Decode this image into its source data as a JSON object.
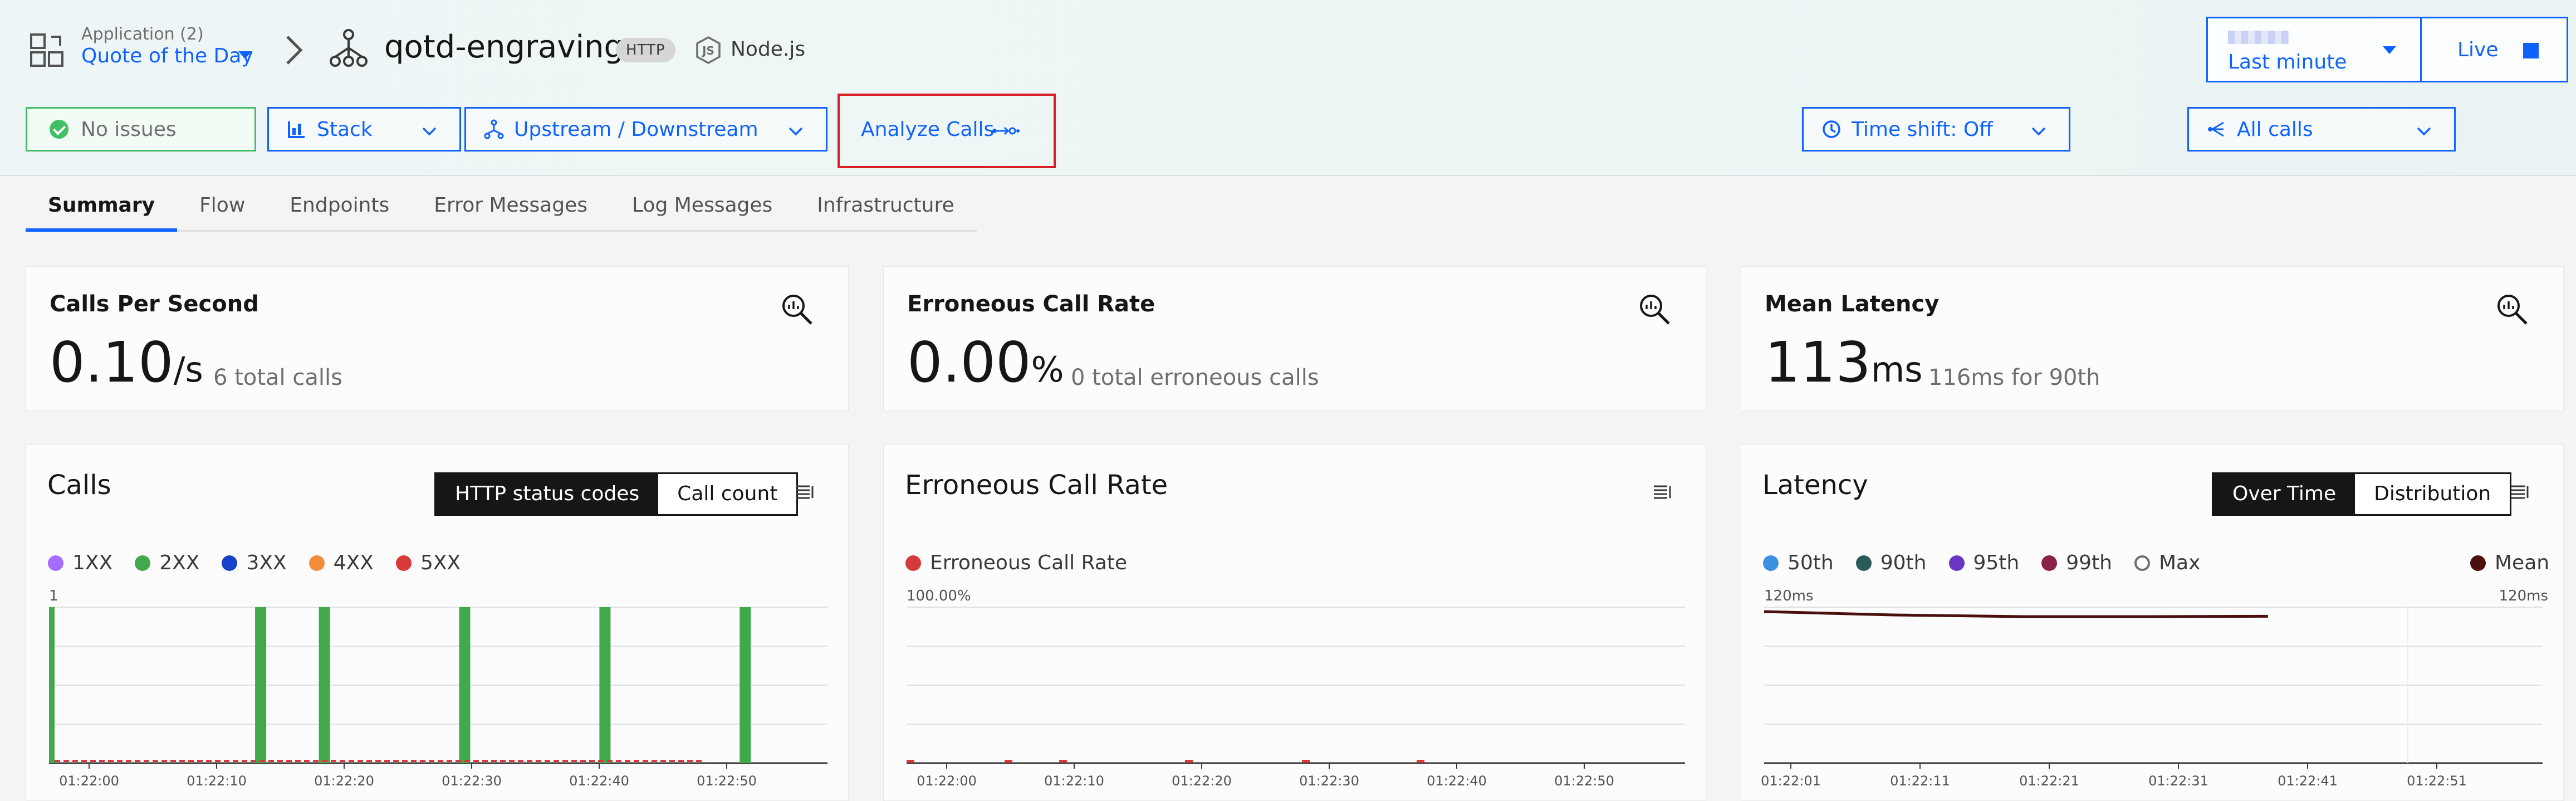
{
  "header": {
    "app_label": "Application (2)",
    "app_name": "Quote of the Day",
    "service_name": "qotd-engraving",
    "protocol_tag": "HTTP",
    "runtime_label": "Node.js",
    "status_label": "No issues",
    "stack_label": "Stack",
    "upstream_label": "Upstream / Downstream",
    "analyze_label": "Analyze Calls",
    "time_shift_label": "Time shift: Off",
    "all_calls_label": "All calls",
    "time_range_label": "Last minute",
    "live_label": "Live"
  },
  "tabs": [
    {
      "label": "Summary",
      "active": true
    },
    {
      "label": "Flow",
      "active": false
    },
    {
      "label": "Endpoints",
      "active": false
    },
    {
      "label": "Error Messages",
      "active": false
    },
    {
      "label": "Log Messages",
      "active": false
    },
    {
      "label": "Infrastructure",
      "active": false
    }
  ],
  "kpis": [
    {
      "title": "Calls Per Second",
      "value": "0.10",
      "unit": "/s",
      "sub": "6 total calls"
    },
    {
      "title": "Erroneous Call Rate",
      "value": "0.00",
      "unit": "%",
      "sub": "0 total erroneous calls"
    },
    {
      "title": "Mean Latency",
      "value": "113",
      "unit": "ms",
      "sub": "116ms for 90th"
    }
  ],
  "calls_panel": {
    "title": "Calls",
    "toggle": [
      "HTTP status codes",
      "Call count"
    ],
    "legend": [
      {
        "label": "1XX",
        "color": "#a56eff"
      },
      {
        "label": "2XX",
        "color": "#42a84c"
      },
      {
        "label": "3XX",
        "color": "#1741c9"
      },
      {
        "label": "4XX",
        "color": "#f08c3c"
      },
      {
        "label": "5XX",
        "color": "#d63a3a"
      }
    ]
  },
  "error_panel": {
    "title": "Erroneous Call Rate",
    "legend": [
      {
        "label": "Erroneous Call Rate",
        "color": "#d63a3a"
      }
    ]
  },
  "latency_panel": {
    "title": "Latency",
    "toggle": [
      "Over Time",
      "Distribution"
    ],
    "legend": [
      {
        "label": "50th",
        "color": "#3d8fe0"
      },
      {
        "label": "90th",
        "color": "#2a5a5a"
      },
      {
        "label": "95th",
        "color": "#6a35c2"
      },
      {
        "label": "99th",
        "color": "#8a2146"
      },
      {
        "label": "Max",
        "color": "hollow"
      }
    ],
    "mean_label": "Mean",
    "mean_color": "#4a0f0f"
  },
  "chart_data": [
    {
      "type": "bar",
      "ylim": [
        0,
        1
      ],
      "y_tick_label": "1",
      "x_ticks": [
        "01:22:00",
        "01:22:10",
        "01:22:20",
        "01:22:30",
        "01:22:40",
        "01:22:50"
      ],
      "x_range_seconds": [
        0,
        60
      ],
      "series": [
        {
          "name": "2XX",
          "color": "#42a84c",
          "points": [
            [
              0,
              1
            ],
            [
              9,
              1
            ],
            [
              14,
              1
            ],
            [
              25,
              1
            ],
            [
              36,
              1
            ],
            [
              47,
              1
            ]
          ]
        },
        {
          "name": "5XX",
          "color": "#d63a3a",
          "points": [
            [
              0,
              0
            ],
            [
              62,
              0
            ]
          ]
        }
      ]
    },
    {
      "type": "line",
      "y_tick_label": "100.00%",
      "x_ticks": [
        "01:22:00",
        "01:22:10",
        "01:22:20",
        "01:22:30",
        "01:22:40",
        "01:22:50"
      ],
      "series": [
        {
          "name": "Erroneous Call Rate",
          "color": "#d63a3a",
          "points": [
            [
              0,
              0
            ],
            [
              9,
              0
            ],
            [
              14,
              0
            ],
            [
              25,
              0
            ],
            [
              36,
              0
            ],
            [
              47,
              0
            ]
          ]
        }
      ]
    },
    {
      "type": "line",
      "y_tick_left": "120ms",
      "y_tick_right": "120ms",
      "x_ticks": [
        "01:22:01",
        "01:22:11",
        "01:22:21",
        "01:22:31",
        "01:22:41",
        "01:22:51"
      ],
      "series": [
        {
          "name": "Mean",
          "color": "#4a0f0f",
          "points": [
            [
              0,
              120
            ],
            [
              10,
              119
            ],
            [
              20,
              118.5
            ],
            [
              30,
              118.5
            ],
            [
              39,
              118.6
            ]
          ]
        }
      ]
    }
  ]
}
